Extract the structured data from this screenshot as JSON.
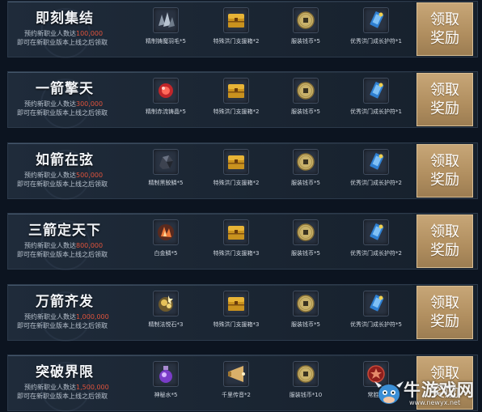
{
  "desc_prefix": "预约新职业人数达",
  "desc_line2": "即可在新职业版本上线之后领取",
  "claim_label": [
    "领取",
    "奖励"
  ],
  "tiers": [
    {
      "title": "即刻集结",
      "count": "100,000",
      "items": [
        {
          "icon": "crystal-shards-icon",
          "label": "精制铸魔羽毛*5"
        },
        {
          "icon": "treasure-chest-icon",
          "label": "特殊洪门支援箱*2"
        },
        {
          "icon": "coin-icon",
          "label": "服装钱币*5"
        },
        {
          "icon": "talisman-icon",
          "label": "优秀洪门成长护符*1"
        }
      ]
    },
    {
      "title": "一箭擎天",
      "count": "300,000",
      "items": [
        {
          "icon": "red-orb-icon",
          "label": "精制赤流铸晶*5"
        },
        {
          "icon": "treasure-chest-icon",
          "label": "特殊洪门支援箱*2"
        },
        {
          "icon": "coin-icon",
          "label": "服装钱币*5"
        },
        {
          "icon": "talisman-icon",
          "label": "优秀洪门成长护符*1"
        }
      ]
    },
    {
      "title": "如箭在弦",
      "count": "500,000",
      "items": [
        {
          "icon": "dark-ore-icon",
          "label": "精制黑鲛鳞*5"
        },
        {
          "icon": "treasure-chest-icon",
          "label": "特殊洪门支援箱*2"
        },
        {
          "icon": "coin-icon",
          "label": "服装钱币*5"
        },
        {
          "icon": "talisman-icon",
          "label": "优秀洪门成长护符*2"
        }
      ]
    },
    {
      "title": "三箭定天下",
      "count": "800,000",
      "items": [
        {
          "icon": "fire-crystal-icon",
          "label": "白金鳞*5"
        },
        {
          "icon": "treasure-chest-icon",
          "label": "特殊洪门支援箱*3"
        },
        {
          "icon": "coin-icon",
          "label": "服装钱币*5"
        },
        {
          "icon": "talisman-icon",
          "label": "优秀洪门成长护符*2"
        }
      ]
    },
    {
      "title": "万箭齐发",
      "count": "1,000,000",
      "items": [
        {
          "icon": "gold-ore-icon",
          "label": "精制法悦石*3"
        },
        {
          "icon": "treasure-chest-icon",
          "label": "特殊洪门支援箱*3"
        },
        {
          "icon": "coin-icon",
          "label": "服装钱币*5"
        },
        {
          "icon": "talisman-icon",
          "label": "优秀洪门成长护符*5"
        }
      ]
    },
    {
      "title": "突破界限",
      "count": "1,500,000",
      "items": [
        {
          "icon": "purple-potion-icon",
          "label": "神秘水*5"
        },
        {
          "icon": "horn-icon",
          "label": "千里传音*2"
        },
        {
          "icon": "coin-icon",
          "label": "服装钱币*10"
        },
        {
          "icon": "red-medal-icon",
          "label": "常胜牌"
        }
      ]
    }
  ],
  "watermark": {
    "text": "牛游戏网",
    "url": "www.newyx.net"
  },
  "colors": {
    "count_highlight": "#e0533c",
    "claim_button": "#b08e5f",
    "background": "#0c1420"
  }
}
